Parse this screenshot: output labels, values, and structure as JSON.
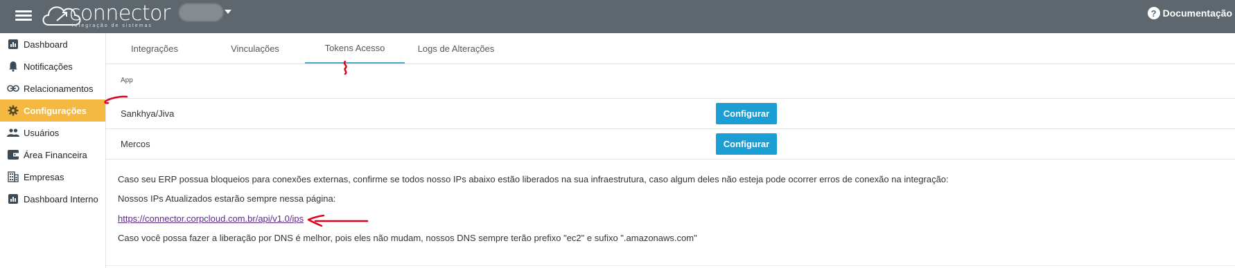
{
  "header": {
    "logo_text": "connector",
    "logo_subtitle": "integração de sistemas",
    "docs_label": "Documentação",
    "docs_icon": "help-circle-icon"
  },
  "sidebar": {
    "items": [
      {
        "label": "Dashboard",
        "icon": "chart-icon"
      },
      {
        "label": "Notificações",
        "icon": "bell-icon"
      },
      {
        "label": "Relacionamentos",
        "icon": "link-icon"
      },
      {
        "label": "Configurações",
        "icon": "gear-icon",
        "active": true
      },
      {
        "label": "Usuários",
        "icon": "users-icon"
      },
      {
        "label": "Área Financeira",
        "icon": "wallet-icon"
      },
      {
        "label": "Empresas",
        "icon": "building-icon"
      },
      {
        "label": "Dashboard Interno",
        "icon": "chart-icon"
      }
    ]
  },
  "tabs": [
    {
      "label": "Integrações"
    },
    {
      "label": "Vinculações"
    },
    {
      "label": "Tokens Acesso",
      "active": true
    },
    {
      "label": "Logs de Alterações"
    }
  ],
  "table": {
    "header": "App",
    "rows": [
      {
        "name": "Sankhya/Jiva",
        "action": "Configurar"
      },
      {
        "name": "Mercos",
        "action": "Configurar"
      }
    ]
  },
  "info": {
    "line1": "Caso seu ERP possua bloqueios para conexões externas, confirme se todos nosso IPs abaixo estão liberados na sua infraestrutura, caso algum deles não esteja pode ocorrer erros de conexão na integração:",
    "line2": "Nossos IPs Atualizados estarão sempre nessa página:",
    "link": "https://connector.corpcloud.com.br/api/v1.0/ips",
    "line3": "Caso você possa fazer a liberação por DNS é melhor, pois eles não mudam, nossos DNS sempre terão prefixo \"ec2\" e sufixo \".amazonaws.com\""
  },
  "colors": {
    "topbar": "#5d676d",
    "active_sidebar": "#f5b942",
    "button": "#1a9ed4",
    "tab_underline": "#4aa9c6",
    "annotation": "#e0001b"
  }
}
